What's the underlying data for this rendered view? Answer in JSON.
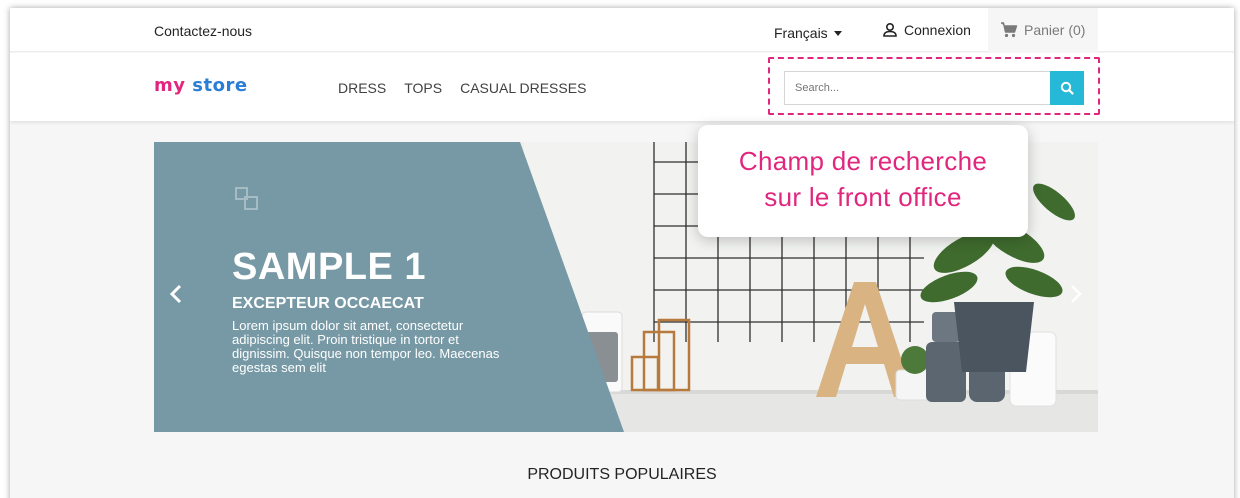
{
  "topbar": {
    "contact_label": "Contactez-nous",
    "language_label": "Français",
    "login_label": "Connexion",
    "cart_label": "Panier (0)"
  },
  "header": {
    "logo_part1": "my",
    "logo_part2": "store",
    "nav": [
      "DRESS",
      "TOPS",
      "CASUAL DRESSES"
    ],
    "search_placeholder": "Search..."
  },
  "slider": {
    "title": "SAMPLE 1",
    "subtitle": "EXCEPTEUR OCCAECAT",
    "description": "Lorem ipsum dolor sit amet, consectetur adipiscing elit. Proin tristique in tortor et dignissim. Quisque non tempor leo. Maecenas egestas sem elit",
    "panel_color": "#7699a5"
  },
  "annotation": {
    "line1": "Champ de recherche",
    "line2": "sur le front office",
    "color": "#e0267d"
  },
  "section": {
    "title": "PRODUITS POPULAIRES"
  },
  "colors": {
    "accent": "#25b9d7",
    "highlight": "#e0267d"
  }
}
